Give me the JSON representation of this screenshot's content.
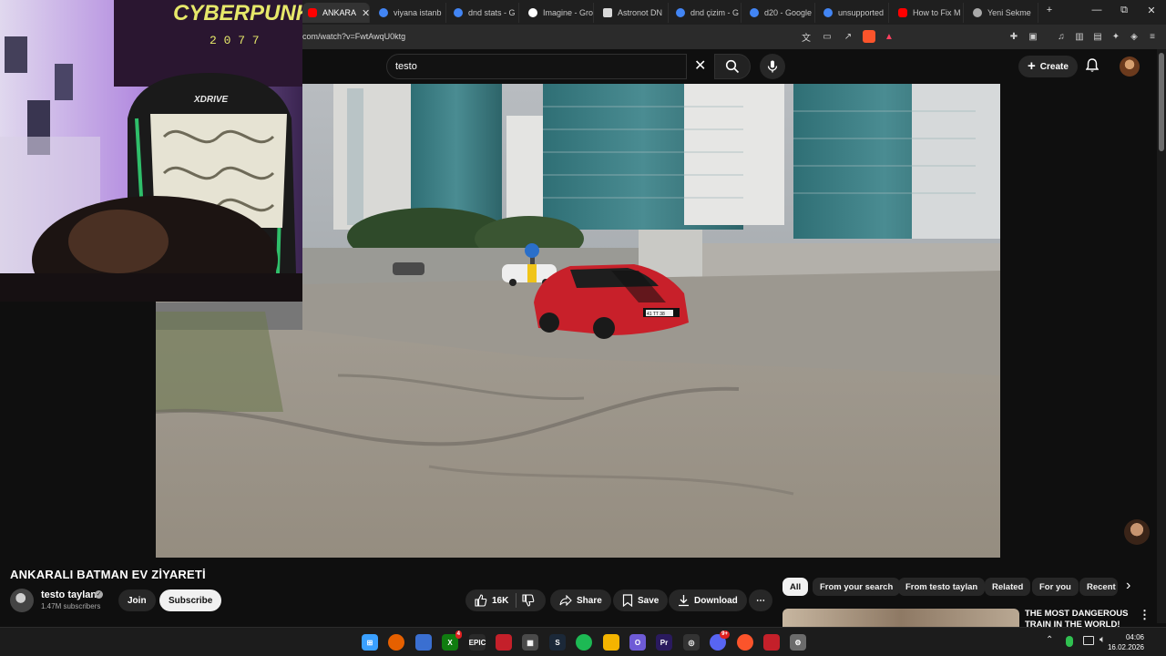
{
  "browser": {
    "tabs": [
      {
        "label": "ANKARA",
        "color": "#ff0000",
        "active": true
      },
      {
        "label": "viyana istanb",
        "color": "#4285f4"
      },
      {
        "label": "dnd stats - G",
        "color": "#4285f4"
      },
      {
        "label": "Imagine - Gro",
        "color": "#ffffff"
      },
      {
        "label": "Astronot DN",
        "color": "#d9d9d9"
      },
      {
        "label": "dnd çizim - G",
        "color": "#4285f4"
      },
      {
        "label": "d20 - Google",
        "color": "#4285f4"
      },
      {
        "label": "unsupported",
        "color": "#4285f4"
      },
      {
        "label": "How to Fix M",
        "color": "#ff0000"
      },
      {
        "label": "Yeni Sekme",
        "color": "#aaaaaa"
      }
    ],
    "new_tab": "+",
    "window_controls": {
      "minimize": "—",
      "restore": "⧉",
      "close": "✕"
    },
    "url": "com/watch?v=FwtAwqU0ktg"
  },
  "youtube": {
    "search_value": "testo",
    "create_label": "Create",
    "video_title": "ANKARALI BATMAN EV ZİYARETİ",
    "channel": {
      "name": "testo taylan",
      "subscribers": "1.47M subscribers",
      "verified": "✓"
    },
    "join_label": "Join",
    "subscribe_label": "Subscribe",
    "likes": "16K",
    "share_label": "Share",
    "save_label": "Save",
    "download_label": "Download",
    "more_label": "⋯",
    "chips": [
      "All",
      "From your search",
      "From testo taylan",
      "Related",
      "For you",
      "Recent"
    ],
    "rec_title": "THE MOST DANGEROUS TRAIN IN THE WORLD!",
    "rec_menu": "⋮",
    "chip_next": "›"
  },
  "video_scene": {
    "plate": "41 TT 38"
  },
  "webcam_overlay": {
    "chair_brand": "XDRIVE",
    "poster_text": "CYBERPUNK",
    "poster_year": "2 0 7 7"
  },
  "taskbar": {
    "time": "04:06",
    "date": "16.02.2026",
    "apps": [
      {
        "name": "windows-start",
        "color": "#3aa0ff",
        "glyph": "⊞"
      },
      {
        "name": "firefox",
        "color": "#e66000",
        "glyph": ""
      },
      {
        "name": "remote",
        "color": "#3a6fd1",
        "glyph": ""
      },
      {
        "name": "xbox",
        "color": "#107c10",
        "glyph": "X",
        "badge": "4"
      },
      {
        "name": "epic",
        "color": "#2a2a2a",
        "glyph": "EPIC"
      },
      {
        "name": "app-red-1",
        "color": "#c4202a",
        "glyph": ""
      },
      {
        "name": "calculator",
        "color": "#4a4a4a",
        "glyph": "▦"
      },
      {
        "name": "steam",
        "color": "#1b2838",
        "glyph": "S"
      },
      {
        "name": "spotify",
        "color": "#1db954",
        "glyph": ""
      },
      {
        "name": "file-explorer",
        "color": "#f4b400",
        "glyph": ""
      },
      {
        "name": "opera",
        "color": "#6e5bd6",
        "glyph": "O"
      },
      {
        "name": "premiere",
        "color": "#2a1a5e",
        "glyph": "Pr"
      },
      {
        "name": "obs",
        "color": "#333",
        "glyph": "◎"
      },
      {
        "name": "discord",
        "color": "#5865f2",
        "glyph": "",
        "badge": "9+"
      },
      {
        "name": "brave",
        "color": "#fb542b",
        "glyph": ""
      },
      {
        "name": "app-red-2",
        "color": "#c4202a",
        "glyph": ""
      },
      {
        "name": "settings",
        "color": "#6b6b6b",
        "glyph": "⚙"
      }
    ],
    "tray": {
      "chevron": "⌃"
    }
  },
  "colors": {
    "accent": "#ff0000",
    "bg": "#0f0f0f",
    "chip": "#272727"
  }
}
